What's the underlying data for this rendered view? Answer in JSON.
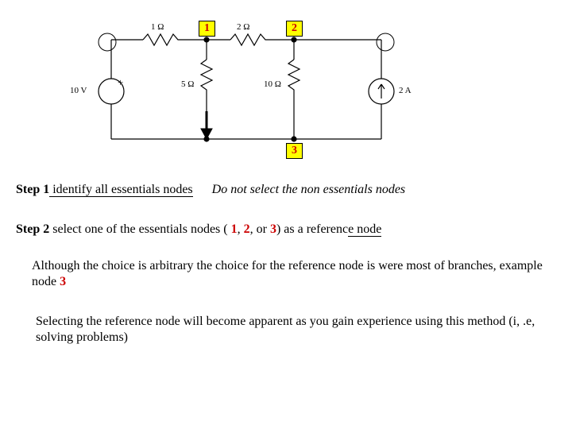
{
  "circuit": {
    "nodes": {
      "n1": "1",
      "n2": "2",
      "n3": "3"
    },
    "labels": {
      "r1": "1 Ω",
      "r2": "2 Ω",
      "r5": "5 Ω",
      "r10": "10 Ω",
      "vsrc": "10 V",
      "vsrc_plus": "+",
      "isrc": "2 A"
    }
  },
  "step1": {
    "lead": "Step 1",
    "rest_a": "  identify all essentials",
    "rest_b": " nodes",
    "note": "Do not select the non essentials nodes"
  },
  "step2": {
    "lead": "Step 2",
    "rest_a": "  select one of the essentials nodes ( ",
    "n1": "1",
    "comma1": ", ",
    "n2": "2",
    "comma2": ", or ",
    "n3": "3",
    "rest_b": ") as a referenc",
    "rest_c": "e node"
  },
  "para1": {
    "a": "Although the choice is arbitrary the choice for the reference node is were most of branches, example node  ",
    "n3": "3"
  },
  "para2": "Selecting the reference node will become apparent as you gain experience using this method (i, .e, solving problems)"
}
